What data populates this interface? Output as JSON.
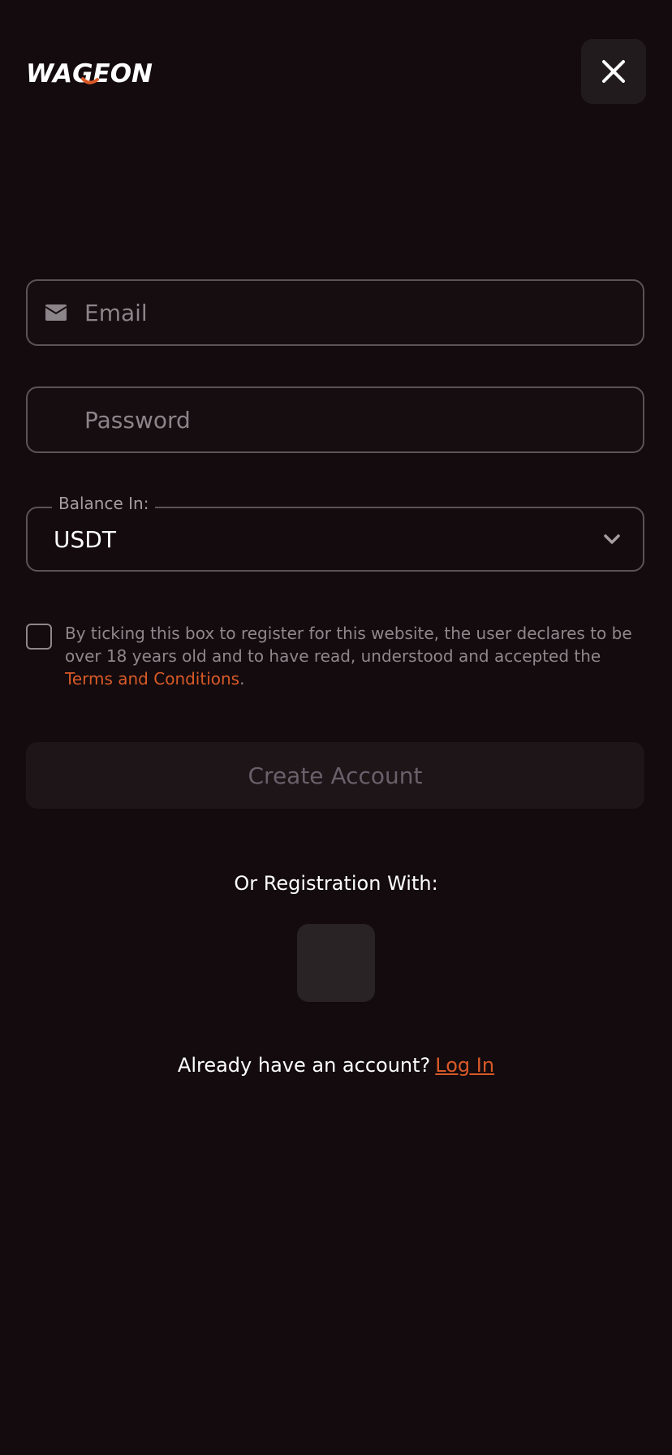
{
  "header": {
    "logo_text": "WAGEON",
    "close_icon": "close-icon"
  },
  "form": {
    "email": {
      "placeholder": "Email",
      "value": "",
      "icon": "envelope-icon"
    },
    "password": {
      "placeholder": "Password",
      "value": ""
    },
    "balance": {
      "label": "Balance In:",
      "value": "USDT",
      "icon": "chevron-down-icon"
    },
    "consent": {
      "checked": false,
      "text": "By ticking this box to register for this website, the user declares to be over 18 years old and to have read, understood and accepted the ",
      "link": "Terms and Conditions",
      "suffix": "."
    },
    "submit_label": "Create Account"
  },
  "social": {
    "label": "Or Registration With:"
  },
  "login": {
    "prompt": "Already have an account?",
    "link": "Log In"
  },
  "colors": {
    "background": "#130b0e",
    "accent": "#d95a27",
    "border": "#5a5357"
  }
}
